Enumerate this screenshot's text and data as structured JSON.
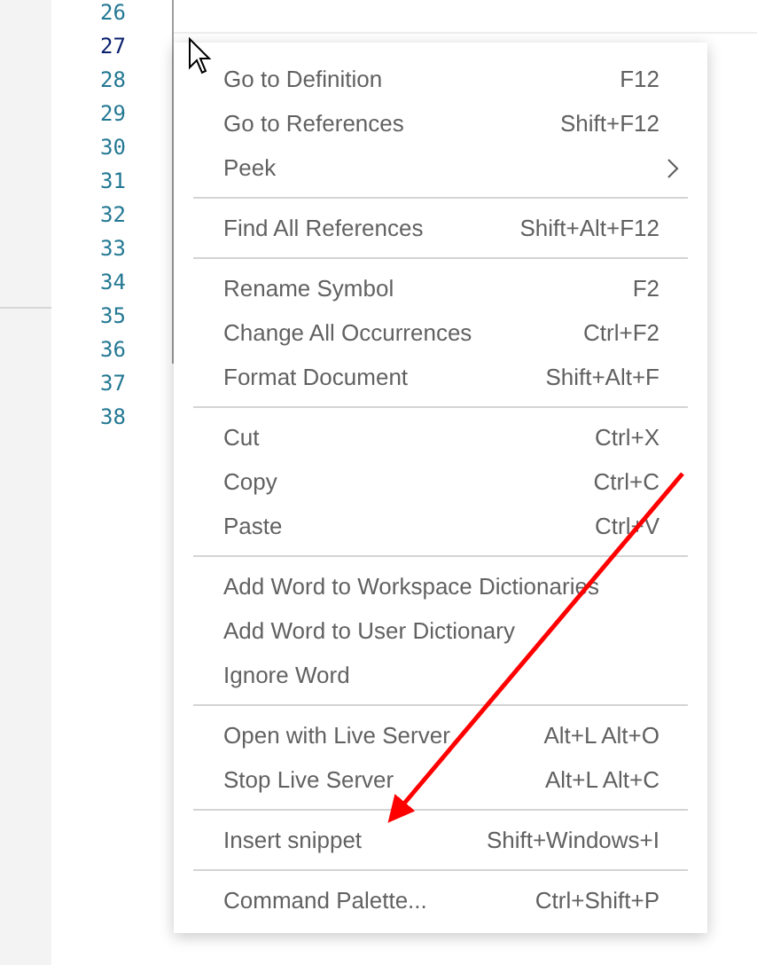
{
  "editor": {
    "line_numbers": [
      {
        "number": "26",
        "selected": false
      },
      {
        "number": "27",
        "selected": true
      },
      {
        "number": "28",
        "selected": false
      },
      {
        "number": "29",
        "selected": false
      },
      {
        "number": "30",
        "selected": false
      },
      {
        "number": "31",
        "selected": false
      },
      {
        "number": "32",
        "selected": false
      },
      {
        "number": "33",
        "selected": false
      },
      {
        "number": "34",
        "selected": false
      },
      {
        "number": "35",
        "selected": false
      },
      {
        "number": "36",
        "selected": false
      },
      {
        "number": "37",
        "selected": false
      },
      {
        "number": "38",
        "selected": false
      }
    ]
  },
  "context_menu": {
    "groups": [
      [
        {
          "kind": "command",
          "label": "Go to Definition",
          "shortcut": "F12"
        },
        {
          "kind": "command",
          "label": "Go to References",
          "shortcut": "Shift+F12"
        },
        {
          "kind": "submenu",
          "label": "Peek"
        }
      ],
      [
        {
          "kind": "command",
          "label": "Find All References",
          "shortcut": "Shift+Alt+F12"
        }
      ],
      [
        {
          "kind": "command",
          "label": "Rename Symbol",
          "shortcut": "F2"
        },
        {
          "kind": "command",
          "label": "Change All Occurrences",
          "shortcut": "Ctrl+F2"
        },
        {
          "kind": "command",
          "label": "Format Document",
          "shortcut": "Shift+Alt+F"
        }
      ],
      [
        {
          "kind": "command",
          "label": "Cut",
          "shortcut": "Ctrl+X"
        },
        {
          "kind": "command",
          "label": "Copy",
          "shortcut": "Ctrl+C"
        },
        {
          "kind": "command",
          "label": "Paste",
          "shortcut": "Ctrl+V"
        }
      ],
      [
        {
          "kind": "command",
          "label": "Add Word to Workspace Dictionaries"
        },
        {
          "kind": "command",
          "label": "Add Word to User Dictionary"
        },
        {
          "kind": "command",
          "label": "Ignore Word"
        }
      ],
      [
        {
          "kind": "command",
          "label": "Open with Live Server",
          "shortcut": "Alt+L Alt+O"
        },
        {
          "kind": "command",
          "label": "Stop Live Server",
          "shortcut": "Alt+L Alt+C"
        }
      ],
      [
        {
          "kind": "command",
          "label": "Insert snippet",
          "shortcut": "Shift+Windows+I"
        }
      ],
      [
        {
          "kind": "command",
          "label": "Command Palette...",
          "shortcut": "Ctrl+Shift+P"
        }
      ]
    ]
  }
}
